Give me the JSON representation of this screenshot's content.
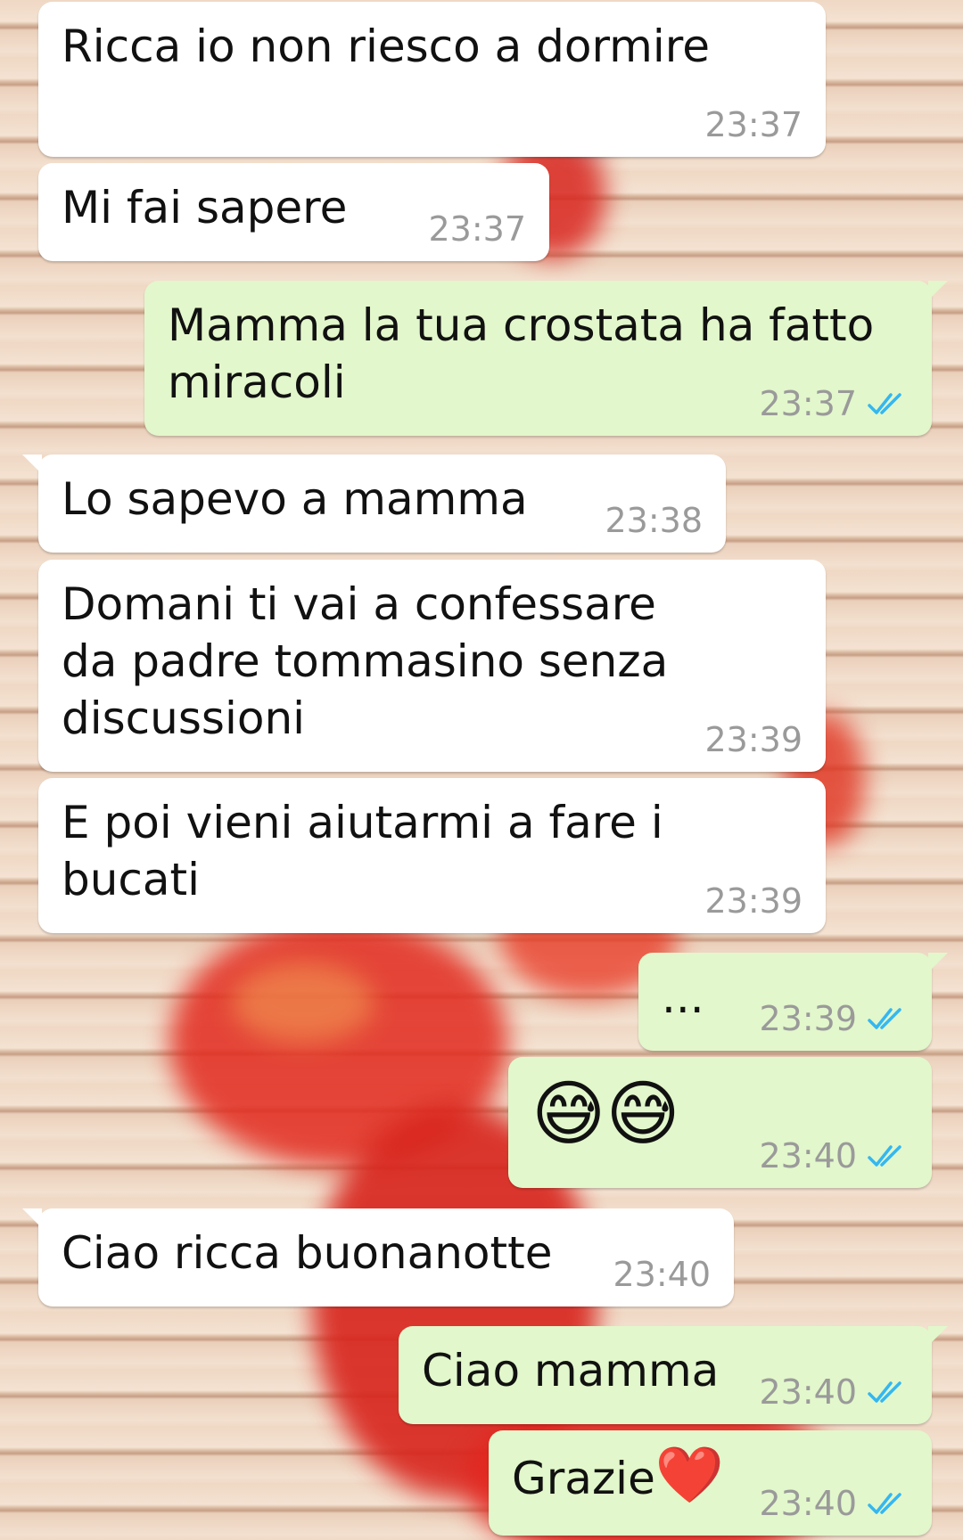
{
  "messages": [
    {
      "text": "Ricca io non riesco a dormire",
      "time": "23:37"
    },
    {
      "text": "Mi fai sapere",
      "time": "23:37"
    },
    {
      "text": "Mamma la tua crostata ha fatto\nmiracoli",
      "time": "23:37"
    },
    {
      "text": "Lo sapevo a mamma",
      "time": "23:38"
    },
    {
      "text": "Domani ti vai a confessare\nda padre tommasino senza\ndiscussioni",
      "time": "23:39"
    },
    {
      "text": "E poi vieni aiutarmi a fare i bucati",
      "time": "23:39"
    },
    {
      "text": "...",
      "time": "23:39"
    },
    {
      "text": "😅😅",
      "time": "23:40"
    },
    {
      "text": "Ciao ricca buonanotte",
      "time": "23:40"
    },
    {
      "text": "Ciao mamma",
      "time": "23:40"
    },
    {
      "text": "Grazie",
      "emoji": "❤️",
      "time": "23:40"
    }
  ],
  "colors": {
    "incoming_bubble": "#ffffff",
    "outgoing_bubble": "#e2f7cb",
    "timestamp": "#9a9a9a",
    "read_ticks": "#34b7f1"
  },
  "icons": {
    "read_receipt": "double-check-icon"
  }
}
